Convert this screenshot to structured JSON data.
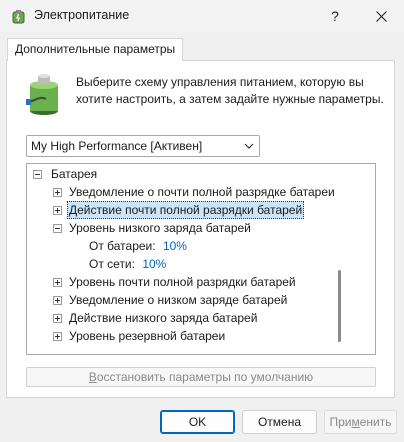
{
  "window": {
    "title": "Электропитание",
    "help_glyph": "?",
    "app_icon": "power-options-icon",
    "close_icon": "close-icon"
  },
  "tab": {
    "label": "Дополнительные параметры"
  },
  "description": "Выберите схему управления питанием, которую вы хотите настроить, а затем задайте нужные параметры.",
  "plan_select": {
    "value": "My High Performance [Активен]",
    "icon": "chevron-down-icon"
  },
  "tree": {
    "root": "Батарея",
    "items": [
      {
        "label": "Уведомление о почти полной разрядке батареи"
      },
      {
        "label": "Действие почти полной разрядки батарей"
      },
      {
        "label": "Уровень низкого заряда батарей"
      },
      {
        "label": "Уровень почти полной разрядки батарей"
      },
      {
        "label": "Уведомление о низком заряде батарей"
      },
      {
        "label": "Действие низкого заряда батарей"
      },
      {
        "label": "Уровень резервной батареи"
      }
    ],
    "settings": [
      {
        "label": "От батареи:",
        "value": "10%"
      },
      {
        "label": "От сети:",
        "value": "10%"
      }
    ]
  },
  "restore_button": {
    "underlined": "В",
    "rest": "осстановить параметры по умолчанию"
  },
  "buttons": {
    "ok": "OK",
    "cancel": "Отмена",
    "apply_prefix": "При",
    "apply_underlined": "м",
    "apply_suffix": "енить"
  },
  "colors": {
    "selection": "#cce4f7",
    "link": "#0064c8",
    "accent": "#0067c0"
  }
}
